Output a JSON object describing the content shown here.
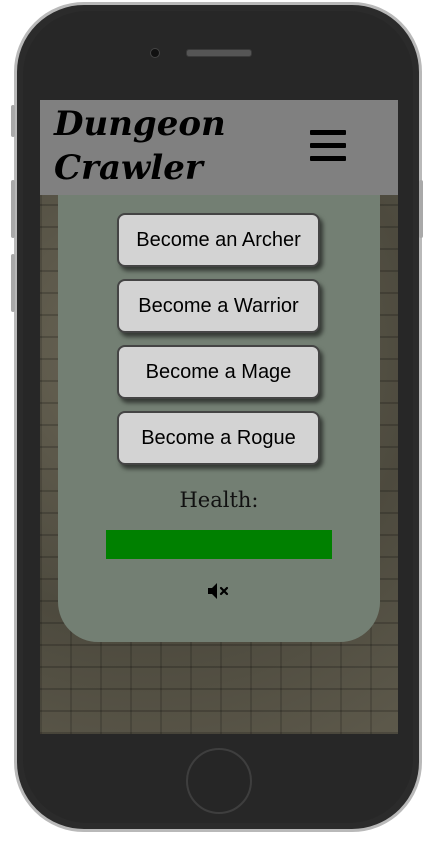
{
  "header": {
    "title_line1": "Dungeon",
    "title_line2": "Crawler",
    "menu_icon": "hamburger-menu-icon"
  },
  "classes": [
    {
      "label": "Become an Archer"
    },
    {
      "label": "Become a Warrior"
    },
    {
      "label": "Become a Mage"
    },
    {
      "label": "Become a Rogue"
    }
  ],
  "health": {
    "label": "Health:",
    "fraction": 1.0,
    "bar_color": "#008000"
  },
  "sound": {
    "icon": "speaker-muted-icon"
  },
  "colors": {
    "header_bg": "#808080",
    "panel_bg": "#737f73",
    "button_bg": "#d3d3d3"
  }
}
